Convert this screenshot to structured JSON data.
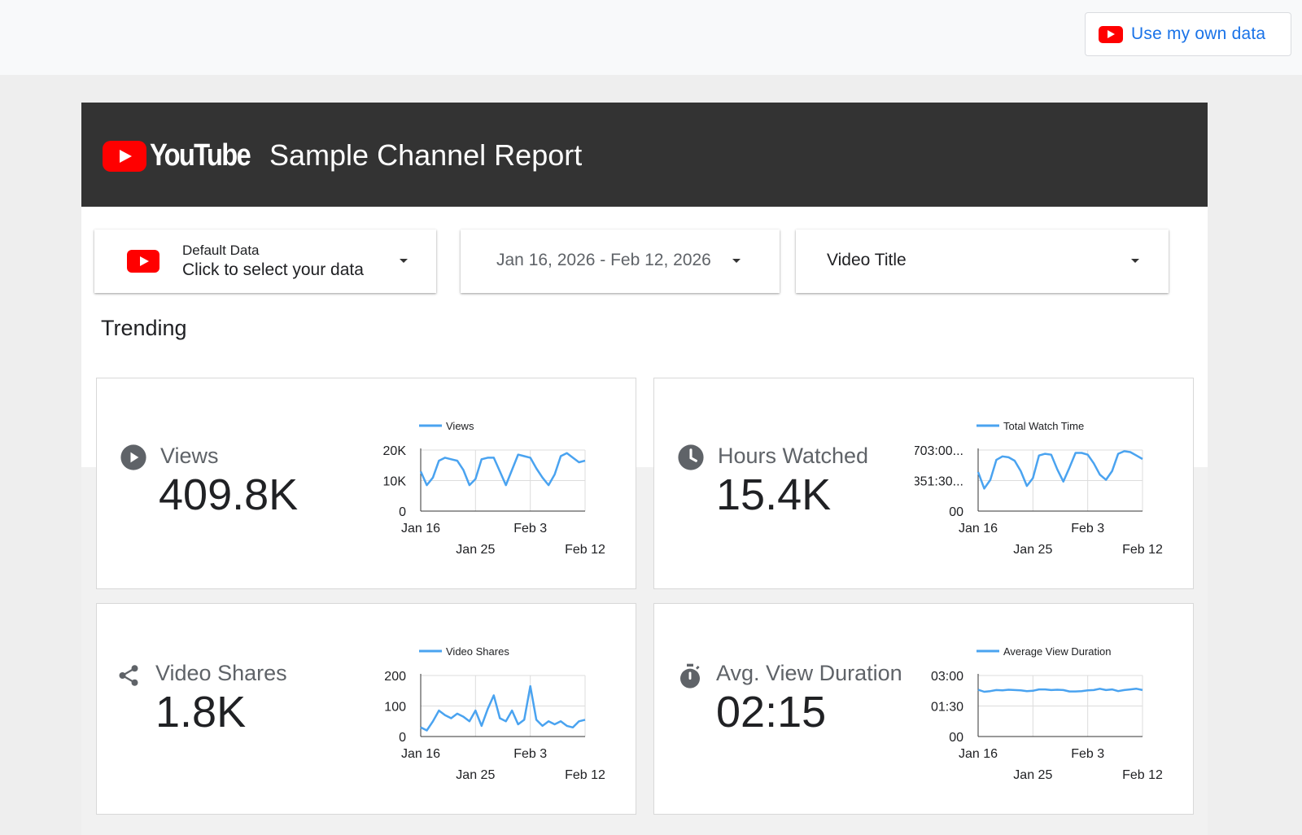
{
  "topbar": {
    "use_own_data_label": "Use my own data"
  },
  "header": {
    "logo_text": "YouTube",
    "title": "Sample Channel Report"
  },
  "controls": {
    "data_source": {
      "line1": "Default Data",
      "line2": "Click to select your data"
    },
    "date_range": {
      "value": "Jan 16, 2026 - Feb 12, 2026"
    },
    "video_title": {
      "value": "Video Title"
    }
  },
  "section_title": "Trending",
  "colors": {
    "series": "#4aa3f0",
    "youtube_red": "#ff0000",
    "header_bg": "#333333",
    "link_blue": "#1a73e8"
  },
  "cards": [
    {
      "icon": "play-circle-icon",
      "label": "Views",
      "value": "409.8K"
    },
    {
      "icon": "clock-icon",
      "label": "Hours Watched",
      "value": "15.4K"
    },
    {
      "icon": "share-icon",
      "label": "Video Shares",
      "value": "1.8K"
    },
    {
      "icon": "stopwatch-icon",
      "label": "Avg. View Duration",
      "value": "02:15"
    }
  ],
  "chart_data": [
    {
      "type": "line",
      "legend": "Views",
      "x_ticks_upper": [
        "Jan 16",
        "Feb 3"
      ],
      "x_ticks_lower": [
        "Jan 25",
        "Feb 12"
      ],
      "y_ticks": [
        "20K",
        "10K",
        "0"
      ],
      "ylim": [
        0,
        20000
      ],
      "x": [
        "Jan 16",
        "Jan 17",
        "Jan 18",
        "Jan 19",
        "Jan 20",
        "Jan 21",
        "Jan 22",
        "Jan 23",
        "Jan 24",
        "Jan 25",
        "Jan 26",
        "Jan 27",
        "Jan 28",
        "Jan 29",
        "Jan 30",
        "Jan 31",
        "Feb 1",
        "Feb 2",
        "Feb 3",
        "Feb 4",
        "Feb 5",
        "Feb 6",
        "Feb 7",
        "Feb 8",
        "Feb 9",
        "Feb 10",
        "Feb 11",
        "Feb 12"
      ],
      "series": [
        {
          "values": [
            13000,
            8500,
            11000,
            16500,
            17500,
            17000,
            16500,
            13500,
            8500,
            10500,
            17000,
            17500,
            17500,
            13000,
            8500,
            13500,
            18500,
            18000,
            17500,
            14000,
            11000,
            8500,
            12000,
            18000,
            19000,
            17500,
            16000,
            16500
          ]
        }
      ]
    },
    {
      "type": "line",
      "legend": "Total Watch Time",
      "x_ticks_upper": [
        "Jan 16",
        "Feb 3"
      ],
      "x_ticks_lower": [
        "Jan 25",
        "Feb 12"
      ],
      "y_ticks": [
        "703:00...",
        "351:30...",
        "00"
      ],
      "ylim": [
        0,
        703
      ],
      "x": [
        "Jan 16",
        "Jan 17",
        "Jan 18",
        "Jan 19",
        "Jan 20",
        "Jan 21",
        "Jan 22",
        "Jan 23",
        "Jan 24",
        "Jan 25",
        "Jan 26",
        "Jan 27",
        "Jan 28",
        "Jan 29",
        "Jan 30",
        "Jan 31",
        "Feb 1",
        "Feb 2",
        "Feb 3",
        "Feb 4",
        "Feb 5",
        "Feb 6",
        "Feb 7",
        "Feb 8",
        "Feb 9",
        "Feb 10",
        "Feb 11",
        "Feb 12"
      ],
      "series": [
        {
          "values": [
            450,
            260,
            360,
            590,
            630,
            620,
            580,
            460,
            290,
            380,
            640,
            660,
            650,
            480,
            340,
            500,
            670,
            670,
            650,
            550,
            420,
            360,
            460,
            660,
            690,
            680,
            640,
            600
          ]
        }
      ]
    },
    {
      "type": "line",
      "legend": "Video Shares",
      "x_ticks_upper": [
        "Jan 16",
        "Feb 3"
      ],
      "x_ticks_lower": [
        "Jan 25",
        "Feb 12"
      ],
      "y_ticks": [
        "200",
        "100",
        "0"
      ],
      "ylim": [
        0,
        200
      ],
      "x": [
        "Jan 16",
        "Jan 17",
        "Jan 18",
        "Jan 19",
        "Jan 20",
        "Jan 21",
        "Jan 22",
        "Jan 23",
        "Jan 24",
        "Jan 25",
        "Jan 26",
        "Jan 27",
        "Jan 28",
        "Jan 29",
        "Jan 30",
        "Jan 31",
        "Feb 1",
        "Feb 2",
        "Feb 3",
        "Feb 4",
        "Feb 5",
        "Feb 6",
        "Feb 7",
        "Feb 8",
        "Feb 9",
        "Feb 10",
        "Feb 11",
        "Feb 12"
      ],
      "series": [
        {
          "values": [
            30,
            20,
            50,
            85,
            70,
            60,
            75,
            65,
            50,
            85,
            35,
            90,
            135,
            60,
            50,
            85,
            40,
            55,
            165,
            55,
            35,
            50,
            40,
            50,
            35,
            30,
            50,
            55
          ]
        }
      ]
    },
    {
      "type": "line",
      "legend": "Average View Duration",
      "x_ticks_upper": [
        "Jan 16",
        "Feb 3"
      ],
      "x_ticks_lower": [
        "Jan 25",
        "Feb 12"
      ],
      "y_ticks": [
        "03:00",
        "01:30",
        "00"
      ],
      "ylim": [
        0,
        180
      ],
      "x": [
        "Jan 16",
        "Jan 17",
        "Jan 18",
        "Jan 19",
        "Jan 20",
        "Jan 21",
        "Jan 22",
        "Jan 23",
        "Jan 24",
        "Jan 25",
        "Jan 26",
        "Jan 27",
        "Jan 28",
        "Jan 29",
        "Jan 30",
        "Jan 31",
        "Feb 1",
        "Feb 2",
        "Feb 3",
        "Feb 4",
        "Feb 5",
        "Feb 6",
        "Feb 7",
        "Feb 8",
        "Feb 9",
        "Feb 10",
        "Feb 11",
        "Feb 12"
      ],
      "series": [
        {
          "values": [
            138,
            132,
            134,
            137,
            136,
            138,
            137,
            136,
            134,
            135,
            139,
            139,
            137,
            138,
            137,
            133,
            133,
            134,
            136,
            137,
            141,
            137,
            139,
            134,
            137,
            139,
            141,
            137
          ]
        }
      ]
    }
  ]
}
